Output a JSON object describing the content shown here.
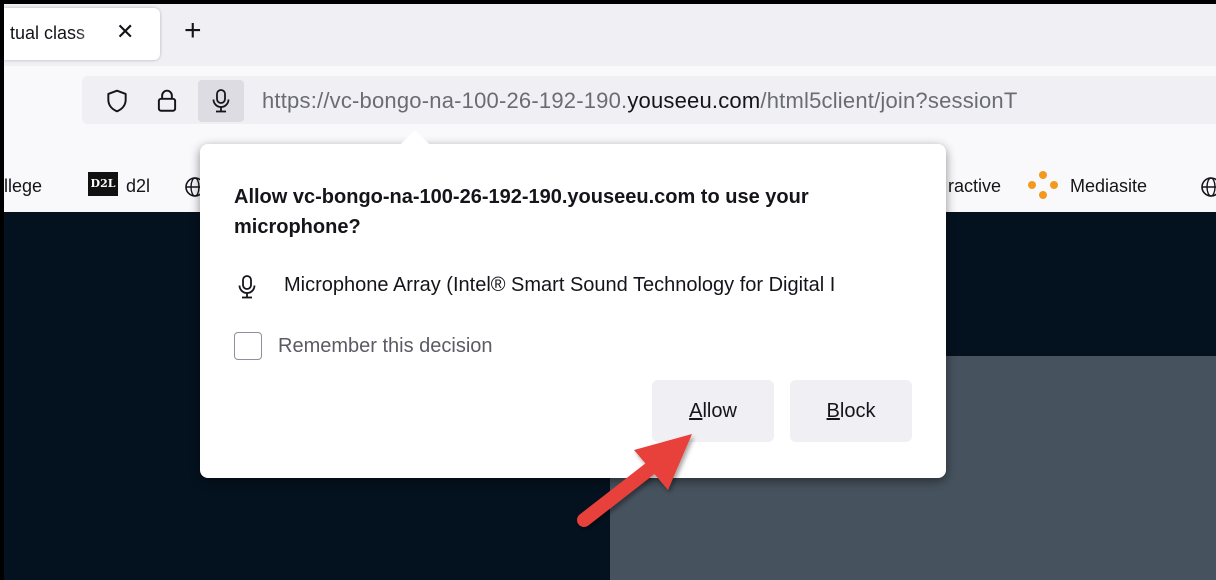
{
  "tab": {
    "title": "tual class",
    "close_glyph": "✕",
    "new_tab_glyph": "+"
  },
  "toolbar": {
    "icons": [
      "shield-icon",
      "lock-icon",
      "microphone-icon"
    ],
    "url_prefix": "https://vc-bongo-na-100-26-192-190.",
    "url_host": "youseeu.com",
    "url_suffix": "/html5client/join?sessionT"
  },
  "bookmarks": {
    "items": [
      {
        "label": "llege"
      },
      {
        "label": "d2l",
        "logo_text": "D2L"
      },
      {
        "label": "ractive"
      },
      {
        "label": "Mediasite"
      }
    ]
  },
  "popup": {
    "prompt": "Allow vc-bongo-na-100-26-192-190.youseeu.com to use your microphone?",
    "device_label": "Microphone Array (Intel® Smart Sound Technology for Digital I",
    "remember_label": "Remember this decision",
    "remember_checked": false,
    "allow_label": "Allow",
    "block_label": "Block"
  },
  "colors": {
    "content_bg": "#04121f",
    "panel_bg": "#46525e",
    "arrow": "#e8403a",
    "mediasite_orange": "#f39a1e"
  }
}
